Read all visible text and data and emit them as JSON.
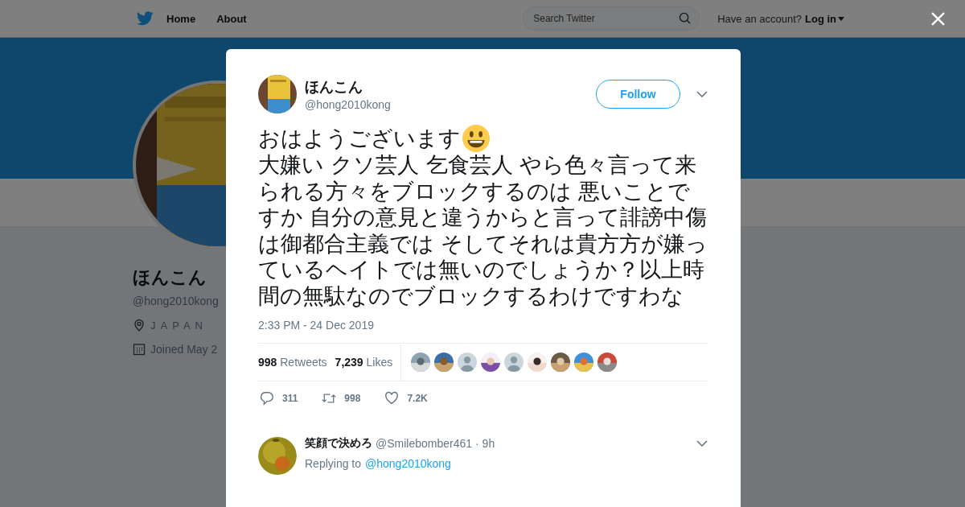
{
  "nav": {
    "items": [
      {
        "label": "Home"
      },
      {
        "label": "About"
      }
    ],
    "search": {
      "placeholder": "Search Twitter"
    },
    "account_prompt": "Have an account?",
    "login": "Log in"
  },
  "profile": {
    "name": "ほんこん",
    "handle": "@hong2010kong",
    "location": "JAPAN",
    "joined": "Joined May 2"
  },
  "tweet": {
    "author": "ほんこん",
    "handle": "@hong2010kong",
    "follow": "Follow",
    "greeting": "おはようございます",
    "body": "大嫌い クソ芸人 乞食芸人 やら色々言って来られる方々をブロックするのは 悪いことですか 自分の意見と違うからと言って誹謗中傷は御都合主義では そしてそれは貴方方が嫌っているヘイトでは無いのでしょうか？以上時間の無駄なのでブロックするわけですわな",
    "timestamp": "2:33 PM - 24 Dec 2019",
    "retweets": {
      "count": "998",
      "label": "Retweets"
    },
    "likes": {
      "count": "7,239",
      "label": "Likes"
    },
    "likers": [
      {
        "kind": "picture"
      },
      {
        "kind": "picture"
      },
      {
        "kind": "default"
      },
      {
        "kind": "picture"
      },
      {
        "kind": "default"
      },
      {
        "kind": "picture"
      },
      {
        "kind": "picture"
      },
      {
        "kind": "picture"
      },
      {
        "kind": "picture"
      }
    ],
    "actions": [
      {
        "kind": "reply",
        "count": "311"
      },
      {
        "kind": "retweet",
        "count": "998"
      },
      {
        "kind": "like",
        "count": "7.2K"
      }
    ]
  },
  "reply": {
    "name": "笑顔で決めろ",
    "handle": "@Smilebomber461",
    "time": "· 9h",
    "replying_to": "Replying to",
    "mention": "@hong2010kong"
  }
}
